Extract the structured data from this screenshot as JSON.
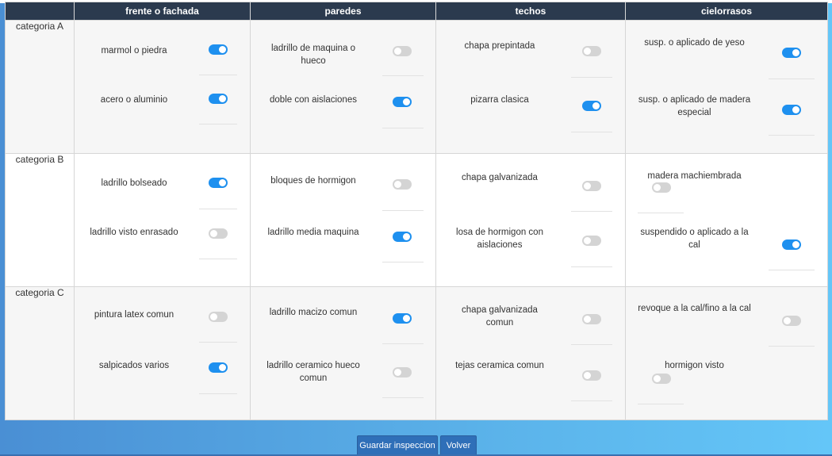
{
  "columns": {
    "blank": "",
    "frente": "frente o fachada",
    "paredes": "paredes",
    "techos": "techos",
    "cielorrasos": "cielorrasos"
  },
  "rows": {
    "a": {
      "label": "categoria A",
      "frente": [
        {
          "label": "marmol o piedra",
          "on": true
        },
        {
          "label": "acero o aluminio",
          "on": true
        }
      ],
      "paredes": [
        {
          "label": "ladrillo de maquina o hueco",
          "on": false
        },
        {
          "label": "doble con aislaciones",
          "on": true
        }
      ],
      "techos": [
        {
          "label": "chapa prepintada",
          "on": false
        },
        {
          "label": "pizarra clasica",
          "on": true
        }
      ],
      "cielorrasos": [
        {
          "label": "susp. o aplicado de yeso",
          "on": true
        },
        {
          "label": "susp. o aplicado de madera especial",
          "on": true
        }
      ]
    },
    "b": {
      "label": "categoria B",
      "frente": [
        {
          "label": "ladrillo bolseado",
          "on": true
        },
        {
          "label": "ladrillo visto enrasado",
          "on": false
        }
      ],
      "paredes": [
        {
          "label": "bloques de hormigon",
          "on": false
        },
        {
          "label": "ladrillo media maquina",
          "on": true
        }
      ],
      "techos": [
        {
          "label": "chapa galvanizada",
          "on": false
        },
        {
          "label": "losa de hormigon con aislaciones",
          "on": false
        }
      ],
      "cielorrasos": [
        {
          "label": "madera machiembrada",
          "on": false
        },
        {
          "label": "suspendido o aplicado a la cal",
          "on": true
        }
      ]
    },
    "c": {
      "label": "categoria C",
      "frente": [
        {
          "label": "pintura latex comun",
          "on": false
        },
        {
          "label": "salpicados varios",
          "on": true
        }
      ],
      "paredes": [
        {
          "label": "ladrillo macizo comun",
          "on": true
        },
        {
          "label": "ladrillo ceramico hueco comun",
          "on": false
        }
      ],
      "techos": [
        {
          "label": "chapa galvanizada comun",
          "on": false
        },
        {
          "label": "tejas ceramica comun",
          "on": false
        }
      ],
      "cielorrasos": [
        {
          "label": "revoque a la cal/fino a la cal",
          "on": false
        },
        {
          "label": "hormigon visto",
          "on": false
        }
      ]
    }
  },
  "buttons": {
    "save": "Guardar inspeccion",
    "back": "Volver"
  },
  "colors": {
    "header_bg": "#2b3a4e",
    "toggle_on": "#1e90ef",
    "toggle_off": "#d4d4d4",
    "button_bg": "#2f6fb8"
  }
}
